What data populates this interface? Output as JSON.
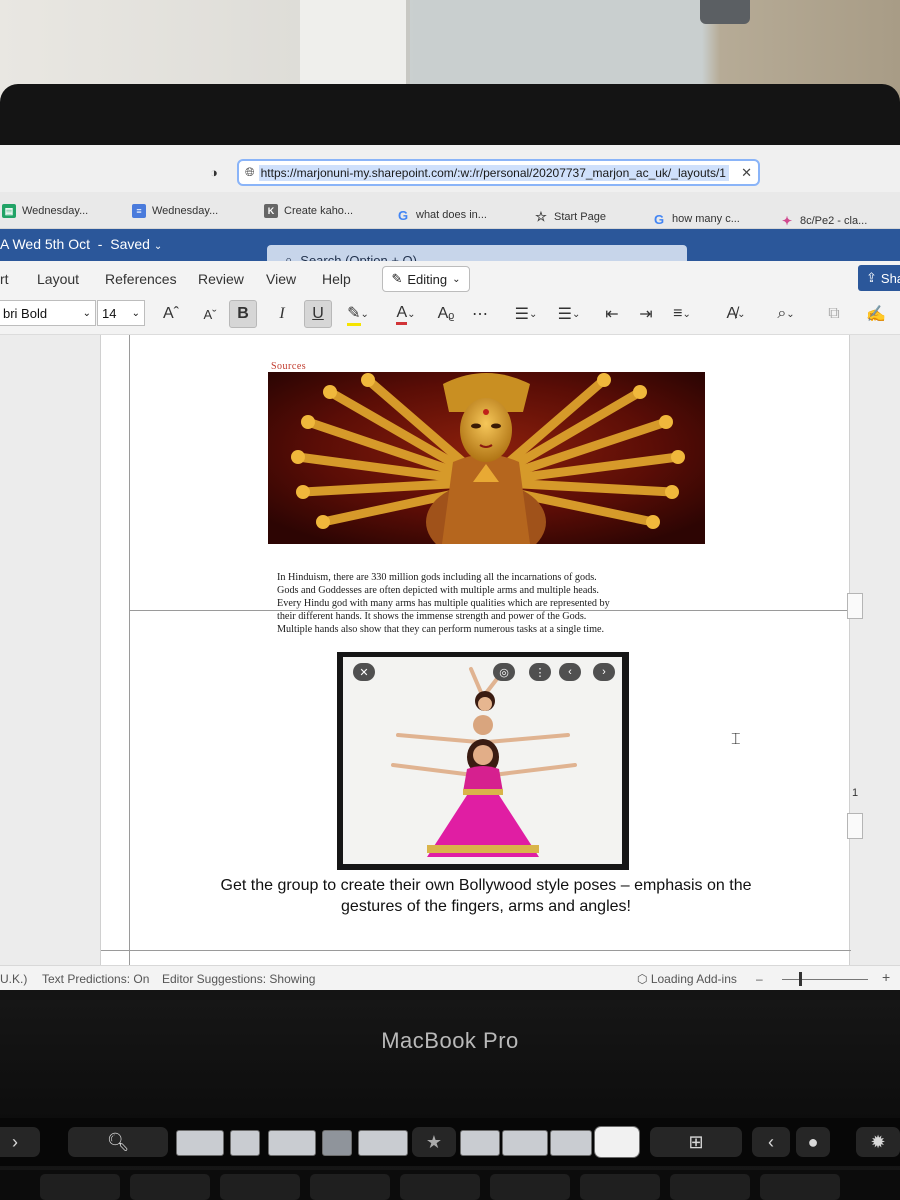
{
  "browser": {
    "url": "https://marjonuni-my.sharepoint.com/:w:/r/personal/20207737_marjon_ac_uk/_layouts/1",
    "tabs": [
      {
        "label": "Wednesday...",
        "icon": "sheets-icon",
        "color": "#21a366"
      },
      {
        "label": "Wednesday...",
        "icon": "docs-icon",
        "color": "#4a7bdc"
      },
      {
        "label": "Create kaho...",
        "icon": "kahoot-icon",
        "color": "#666666"
      },
      {
        "label": "what does in...",
        "icon": "google-icon",
        "color": "#4285f4"
      },
      {
        "label": "Start Page",
        "icon": "star-icon",
        "color": "#444444"
      },
      {
        "label": "how many c...",
        "icon": "google-icon",
        "color": "#4285f4"
      },
      {
        "label": "8c/Pe2 - cla...",
        "icon": "app-icon",
        "color": "#d04a8f"
      }
    ]
  },
  "word": {
    "doc_title": "A Wed 5th Oct",
    "saved_status": "Saved",
    "search_placeholder": "Search (Option + Q)",
    "ribbon_tabs": [
      "rt",
      "Layout",
      "References",
      "Review",
      "View",
      "Help"
    ],
    "editing_mode": "Editing",
    "share_label": "Sha",
    "font_name": "bri Bold",
    "font_size": "14",
    "accent_color": "#2b579a"
  },
  "document": {
    "sources_heading": "Sources",
    "paragraph_lines": [
      "In Hinduism, there are 330 million gods including all the incarnations of gods.",
      "Gods and Goddesses are often depicted with multiple arms and multiple heads.",
      "Every Hindu god with many arms has multiple qualities which are represented by",
      "their different hands. It shows the immense strength and power of the Gods.",
      "Multiple hands also show that they can perform numerous tasks at a single time."
    ],
    "caption_lines": [
      "Get the group to create their own Bollywood style poses – emphasis on the",
      "gestures of the fingers, arms and angles!"
    ],
    "page_number": "1"
  },
  "statusbar": {
    "language": "U.K.)",
    "text_predictions": "Text Predictions: On",
    "editor_suggestions": "Editor Suggestions: Showing",
    "addins": "Loading Add-ins",
    "zoom_out": "–",
    "zoom_in": "+",
    "zoom_level": 0.2
  },
  "device": {
    "brand": "MacBook Pro"
  }
}
